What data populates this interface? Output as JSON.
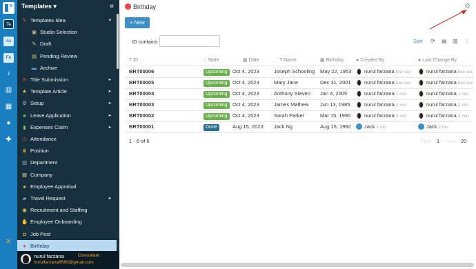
{
  "rail": {
    "workspaces": [
      "Te",
      "Ax",
      "Fe"
    ]
  },
  "sidebar": {
    "title": "Templates",
    "items": [
      {
        "label": "Templates Idea",
        "icon": "pencil-icon",
        "glyph": "✎",
        "color": "#e0504a",
        "level": 0,
        "caret": "▾"
      },
      {
        "label": "Studio Selection",
        "icon": "studio-icon",
        "glyph": "▣",
        "color": "#c8b48a",
        "level": 1
      },
      {
        "label": "Draft",
        "icon": "draft-icon",
        "glyph": "✎",
        "color": "#d8c27a",
        "level": 1
      },
      {
        "label": "Pending Review",
        "icon": "pending-icon",
        "glyph": "▤",
        "color": "#d8c27a",
        "level": 1
      },
      {
        "label": "Archive",
        "icon": "archive-icon",
        "glyph": "▬",
        "color": "#4ea5dd",
        "level": 1
      },
      {
        "label": "Title Submission",
        "icon": "no-entry-icon",
        "glyph": "⊖",
        "color": "#e0504a",
        "level": 0,
        "caret": "▸"
      },
      {
        "label": "Template Article",
        "icon": "star-icon",
        "glyph": "★",
        "color": "#f0c040",
        "level": 0,
        "caret": "▸"
      },
      {
        "label": "Setup",
        "icon": "gear-icon",
        "glyph": "⚙",
        "color": "#b0b8c0",
        "level": 0,
        "caret": "▸"
      },
      {
        "label": "Leave Application",
        "icon": "palm-icon",
        "glyph": "♣",
        "color": "#6ab04c",
        "level": 0,
        "caret": "▸"
      },
      {
        "label": "Expenses Claim",
        "icon": "money-icon",
        "glyph": "▮",
        "color": "#7cc36a",
        "level": 0,
        "caret": "▸"
      },
      {
        "label": "Attendance",
        "icon": "alarm-icon",
        "glyph": "◷",
        "color": "#e0504a",
        "level": 0
      },
      {
        "label": "Position",
        "icon": "trophy-icon",
        "glyph": "♛",
        "color": "#f0c040",
        "level": 0
      },
      {
        "label": "Department",
        "icon": "building-icon",
        "glyph": "▥",
        "color": "#9ab0c4",
        "level": 0
      },
      {
        "label": "Company",
        "icon": "office-icon",
        "glyph": "▦",
        "color": "#c8b48a",
        "level": 0
      },
      {
        "label": "Employee Appraisal",
        "icon": "person-icon",
        "glyph": "●",
        "color": "#f0c040",
        "level": 0
      },
      {
        "label": "Travel Request",
        "icon": "road-icon",
        "glyph": "▰",
        "color": "#8fa3b5",
        "level": 0,
        "caret": "▸"
      },
      {
        "label": "Recruitment and Staffing",
        "icon": "people-icon",
        "glyph": "◉",
        "color": "#f0c040",
        "level": 0
      },
      {
        "label": "Employee Onboarding",
        "icon": "handshake-icon",
        "glyph": "✋",
        "color": "#f0c040",
        "level": 0
      },
      {
        "label": "Job Post",
        "icon": "briefcase-icon",
        "glyph": "◘",
        "color": "#f0c040",
        "level": 0
      },
      {
        "label": "Birthday",
        "icon": "cake-icon",
        "glyph": "●",
        "color": "#e0504a",
        "level": 0,
        "active": true
      }
    ],
    "user": {
      "name": "nurul farzana",
      "role": "Consultant",
      "email": "nurulfarzana8560@gmail.com"
    }
  },
  "page": {
    "title": "Birthday",
    "new_label": "+ New",
    "filter": {
      "field": "ID",
      "operator": "contains",
      "value": ""
    },
    "sort_label": "Sort"
  },
  "grid": {
    "columns": [
      "ID",
      "State",
      "Date",
      "Name",
      "Birthday",
      "Created By",
      "Last Change By"
    ],
    "rows": [
      {
        "id": "BRT00006",
        "state": "Upcoming",
        "date": "Oct 4, 2023",
        "name": "Joseph Schooling",
        "birthday": "May 22, 1953",
        "created_by": "nurul farzana",
        "created_ago": "few sec",
        "changed_by": "nurul farzana",
        "changed_ago": "few sec"
      },
      {
        "id": "BRT00005",
        "state": "Upcoming",
        "date": "Oct 4, 2023",
        "name": "Mary Jane",
        "birthday": "Dec 31, 2001",
        "created_by": "nurul farzana",
        "created_ago": "few sec",
        "changed_by": "nurul farzana",
        "changed_ago": "few sec"
      },
      {
        "id": "BRT00004",
        "state": "Upcoming",
        "date": "Oct 4, 2023",
        "name": "Anthony Steven",
        "birthday": "Jan 4, 2005",
        "created_by": "nurul farzana",
        "created_ago": "1 min",
        "changed_by": "nurul farzana",
        "changed_ago": "1 min"
      },
      {
        "id": "BRT00003",
        "state": "Upcoming",
        "date": "Oct 4, 2023",
        "name": "James Mathew",
        "birthday": "Jun 13, 1985",
        "created_by": "nurul farzana",
        "created_ago": "2 min",
        "changed_by": "nurul farzana",
        "changed_ago": "2 min"
      },
      {
        "id": "BRT00002",
        "state": "Upcoming",
        "date": "Oct 4, 2023",
        "name": "Sarah Parker",
        "birthday": "Mar 15, 1990",
        "created_by": "nurul farzana",
        "created_ago": "3 min",
        "changed_by": "nurul farzana",
        "changed_ago": "3 min"
      },
      {
        "id": "BRT00001",
        "state": "Done",
        "date": "Aug 15, 2023",
        "name": "Jack Ng",
        "birthday": "Aug 15, 1992",
        "created_by": "Jack",
        "created_ago": "2 mo",
        "changed_by": "Jack",
        "changed_ago": "2 mo"
      }
    ],
    "count_text": "1 - 6 of 6",
    "pager": {
      "first": "First",
      "page": "1",
      "last": "Last",
      "size": "20"
    }
  },
  "colors": {
    "accent": "#3c8fc9",
    "sidebar_bg": "#16303f",
    "rail_bg": "#1a7fc0",
    "upcoming": "#6ab04c",
    "done": "#2a6f8f"
  }
}
